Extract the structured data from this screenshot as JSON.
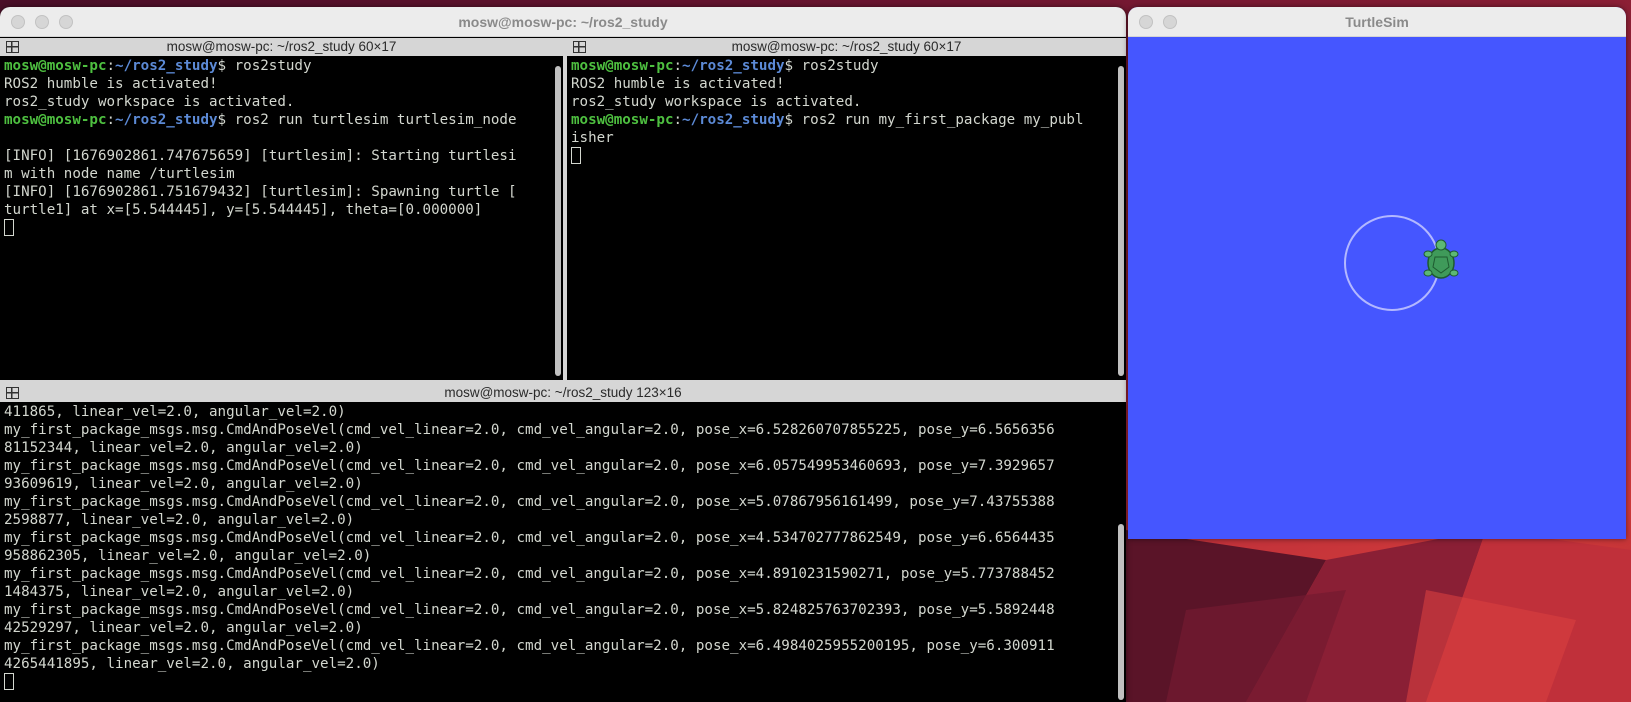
{
  "terminator": {
    "window_title": "mosw@mosw-pc: ~/ros2_study",
    "pane_left": {
      "header": "mosw@mosw-pc: ~/ros2_study 60×17",
      "lines": [
        {
          "type": "prompt",
          "user": "mosw@mosw-pc",
          "sep": ":",
          "path": "~/ros2_study",
          "cmd": "$ ros2study"
        },
        {
          "type": "text",
          "text": "ROS2 humble is activated!"
        },
        {
          "type": "text",
          "text": "ros2_study workspace is activated."
        },
        {
          "type": "prompt",
          "user": "mosw@mosw-pc",
          "sep": ":",
          "path": "~/ros2_study",
          "cmd": "$ ros2 run turtlesim turtlesim_node"
        },
        {
          "type": "text",
          "text": ""
        },
        {
          "type": "text",
          "text": "[INFO] [1676902861.747675659] [turtlesim]: Starting turtlesi"
        },
        {
          "type": "text",
          "text": "m with node name /turtlesim"
        },
        {
          "type": "text",
          "text": "[INFO] [1676902861.751679432] [turtlesim]: Spawning turtle ["
        },
        {
          "type": "text",
          "text": "turtle1] at x=[5.544445], y=[5.544445], theta=[0.000000]"
        }
      ]
    },
    "pane_right": {
      "header": "mosw@mosw-pc: ~/ros2_study 60×17",
      "lines": [
        {
          "type": "prompt",
          "user": "mosw@mosw-pc",
          "sep": ":",
          "path": "~/ros2_study",
          "cmd": "$ ros2study"
        },
        {
          "type": "text",
          "text": "ROS2 humble is activated!"
        },
        {
          "type": "text",
          "text": "ros2_study workspace is activated."
        },
        {
          "type": "prompt",
          "user": "mosw@mosw-pc",
          "sep": ":",
          "path": "~/ros2_study",
          "cmd": "$ ros2 run my_first_package my_publ"
        },
        {
          "type": "text",
          "text": "isher"
        }
      ]
    },
    "pane_bottom": {
      "header": "mosw@mosw-pc: ~/ros2_study 123×16",
      "lines": [
        "411865, linear_vel=2.0, angular_vel=2.0)",
        "my_first_package_msgs.msg.CmdAndPoseVel(cmd_vel_linear=2.0, cmd_vel_angular=2.0, pose_x=6.528260707855225, pose_y=6.5656356",
        "81152344, linear_vel=2.0, angular_vel=2.0)",
        "my_first_package_msgs.msg.CmdAndPoseVel(cmd_vel_linear=2.0, cmd_vel_angular=2.0, pose_x=6.057549953460693, pose_y=7.3929657",
        "93609619, linear_vel=2.0, angular_vel=2.0)",
        "my_first_package_msgs.msg.CmdAndPoseVel(cmd_vel_linear=2.0, cmd_vel_angular=2.0, pose_x=5.07867956161499, pose_y=7.43755388",
        "2598877, linear_vel=2.0, angular_vel=2.0)",
        "my_first_package_msgs.msg.CmdAndPoseVel(cmd_vel_linear=2.0, cmd_vel_angular=2.0, pose_x=4.534702777862549, pose_y=6.6564435",
        "958862305, linear_vel=2.0, angular_vel=2.0)",
        "my_first_package_msgs.msg.CmdAndPoseVel(cmd_vel_linear=2.0, cmd_vel_angular=2.0, pose_x=4.8910231590271, pose_y=5.773788452",
        "1484375, linear_vel=2.0, angular_vel=2.0)",
        "my_first_package_msgs.msg.CmdAndPoseVel(cmd_vel_linear=2.0, cmd_vel_angular=2.0, pose_x=5.824825763702393, pose_y=5.5892448",
        "42529297, linear_vel=2.0, angular_vel=2.0)",
        "my_first_package_msgs.msg.CmdAndPoseVel(cmd_vel_linear=2.0, cmd_vel_angular=2.0, pose_x=6.4984025955200195, pose_y=6.300911",
        "4265441895, linear_vel=2.0, angular_vel=2.0)"
      ]
    }
  },
  "turtlesim": {
    "window_title": "TurtleSim",
    "background_color": "#4556ff",
    "path_color": "#b3b8ff",
    "turtle_color": "#3f9a5a"
  }
}
